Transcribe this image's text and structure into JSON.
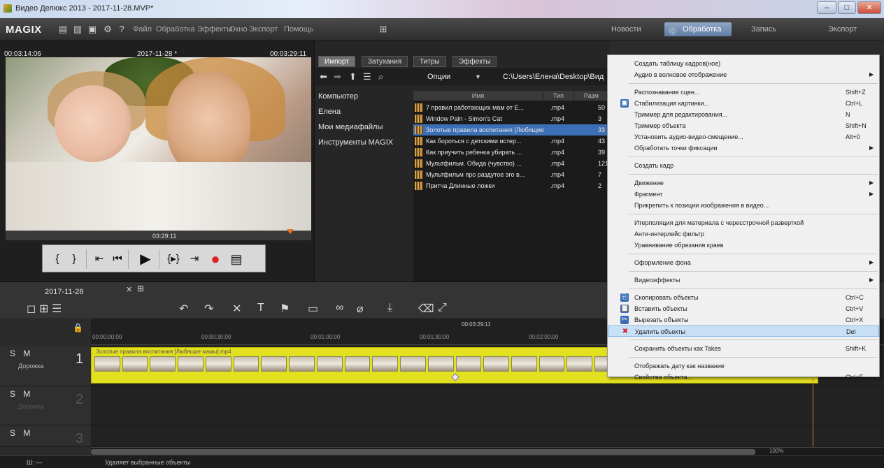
{
  "window": {
    "title": "Видео Делюкс 2013 - 2017-11-28.MVP*",
    "controls": [
      "–",
      "□",
      "✕"
    ]
  },
  "menubar": {
    "logo": "MAGIX",
    "items": [
      "Файл",
      "Обработка",
      "Эффекты",
      "Окно",
      "Экспорт",
      "Помощь"
    ],
    "modes": [
      "Новости",
      "Обработка",
      "Запись",
      "Экспорт"
    ],
    "active_mode": "Обработка"
  },
  "preview": {
    "tc_left": "00:03:14:06",
    "project": "2017-11-28 *",
    "tc_right": "00:03:29:11",
    "scrub_time": "03:29:11"
  },
  "media": {
    "tabs": [
      "Импорт",
      "Затухания",
      "Титры",
      "Эффекты"
    ],
    "active_tab": "Импорт",
    "options_label": "Опции",
    "path": "C:\\Users\\Елена\\Desktop\\Вид",
    "nav": [
      "Компьютер",
      "Елена",
      "Мои медиафайлы",
      "Инструменты MAGIX"
    ],
    "columns": [
      "Имя",
      "Тип",
      "Разм"
    ],
    "files": [
      {
        "name": "7 правил работающих мам от Е...",
        "type": ".mp4",
        "size": "50"
      },
      {
        "name": "Window Pain - Simon's Cat",
        "type": ".mp4",
        "size": "3"
      },
      {
        "name": "Золотые правила воспитания [Любящие мамы]",
        "type": "",
        "size": "33"
      },
      {
        "name": "Как бороться с детскими истер...",
        "type": ".mp4",
        "size": "43"
      },
      {
        "name": "Как приучить ребенка убирать ...",
        "type": ".mp4",
        "size": "39"
      },
      {
        "name": "Мультфильм. Обида (чувство) ...",
        "type": ".mp4",
        "size": "121"
      },
      {
        "name": "Мультфильм про раздутое эго в...",
        "type": ".mp4",
        "size": "7"
      },
      {
        "name": "Притча Длинные ложки",
        "type": ".mp4",
        "size": "2"
      }
    ],
    "selected_index": 2
  },
  "timeline": {
    "project_tab": "2017-11-28",
    "ruler": [
      "00:00:00:00",
      "00:00:30:00",
      "00:01:00:00",
      "00:01:30:00",
      "00:02:00:00"
    ],
    "cursor_time": "00:03:29:11",
    "tracks": [
      {
        "smb": "S M",
        "num": "1",
        "name": "Дорожка"
      },
      {
        "smb": "S M",
        "num": "2",
        "name": "Дорожка"
      },
      {
        "smb": "S M",
        "num": "3",
        "name": ""
      }
    ],
    "clip_title": "Золотые правила воспитания [Любящие мамы].mp4",
    "zoom": "100%"
  },
  "context_menu": {
    "items": [
      {
        "label": "Создать таблицу кадров(ное)",
        "shortcut": "",
        "arrow": false,
        "sep_after": false
      },
      {
        "label": "Аудио в волновое отображение",
        "shortcut": "",
        "arrow": true,
        "sep_after": true
      },
      {
        "label": "Распознавание сцен...",
        "shortcut": "Shift+Z",
        "arrow": false,
        "sep_after": false
      },
      {
        "label": "Стабилизация картинки...",
        "shortcut": "Ctrl+L",
        "arrow": false,
        "sep_after": false,
        "icon": "stabilize-icon"
      },
      {
        "label": "Триммер для редактирования...",
        "shortcut": "N",
        "arrow": false,
        "sep_after": false
      },
      {
        "label": "Триммер объекта",
        "shortcut": "Shift+N",
        "arrow": false,
        "sep_after": false
      },
      {
        "label": "Установить аудио-видео-смещение...",
        "shortcut": "Alt+0",
        "arrow": false,
        "sep_after": false
      },
      {
        "label": "Обработать точки фиксации",
        "shortcut": "",
        "arrow": true,
        "sep_after": true
      },
      {
        "label": "Создать кадр",
        "shortcut": "",
        "arrow": false,
        "sep_after": true
      },
      {
        "label": "Движение",
        "shortcut": "",
        "arrow": true,
        "sep_after": false
      },
      {
        "label": "Фрагмент",
        "shortcut": "",
        "arrow": true,
        "sep_after": false
      },
      {
        "label": "Прикрепить к позиции изображения в видео...",
        "shortcut": "",
        "arrow": false,
        "sep_after": true
      },
      {
        "label": "Итерполяция для материала с чересстрочной разверткой",
        "shortcut": "",
        "arrow": false,
        "sep_after": false
      },
      {
        "label": "Анти-интерлейс фильтр",
        "shortcut": "",
        "arrow": false,
        "sep_after": false
      },
      {
        "label": "Уравнивание обрезания краев",
        "shortcut": "",
        "arrow": false,
        "sep_after": true
      },
      {
        "label": "Оформление фона",
        "shortcut": "",
        "arrow": true,
        "sep_after": true
      },
      {
        "label": "Видеоэффекты",
        "shortcut": "",
        "arrow": true,
        "sep_after": true
      },
      {
        "label": "Скопировать объекты",
        "shortcut": "Ctrl+C",
        "arrow": false,
        "sep_after": false,
        "icon": "copy-icon"
      },
      {
        "label": "Вставить объекты",
        "shortcut": "Ctrl+V",
        "arrow": false,
        "sep_after": false,
        "icon": "paste-icon"
      },
      {
        "label": "Вырезать объекты",
        "shortcut": "Ctrl+X",
        "arrow": false,
        "sep_after": false,
        "icon": "cut-icon"
      },
      {
        "label": "Удалить объекты",
        "shortcut": "Del",
        "arrow": false,
        "sep_after": true,
        "icon": "delete-icon",
        "highlight": true
      },
      {
        "label": "Сохранить объекты как Takes",
        "shortcut": "Shift+K",
        "arrow": false,
        "sep_after": true
      },
      {
        "label": "Отображать дату как название",
        "shortcut": "",
        "arrow": false,
        "sep_after": false
      },
      {
        "label": "Свойства объекта...",
        "shortcut": "Ctrl+E",
        "arrow": false,
        "sep_after": false
      }
    ]
  },
  "status": {
    "left": "Ш:  —",
    "hint": "Удаляет выбранные объекты"
  },
  "colors": {
    "accent": "#3c6fb3",
    "clip": "#e3e020",
    "record": "#e02020",
    "playhead": "#e8742a"
  }
}
